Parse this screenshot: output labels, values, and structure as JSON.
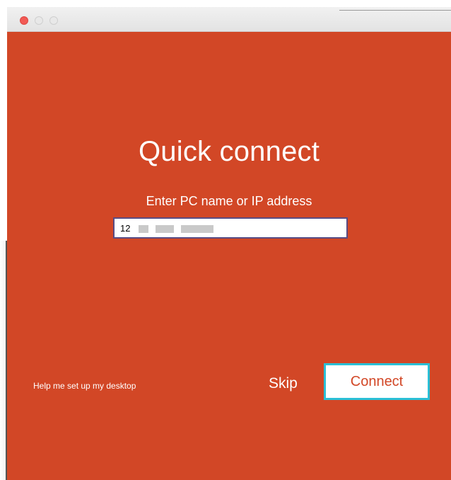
{
  "window": {
    "title": "",
    "accent_color": "#d24726"
  },
  "titlebar": {
    "close_icon": "close-icon",
    "minimize_icon": "minimize-icon",
    "maximize_icon": "maximize-icon"
  },
  "main": {
    "heading": "Quick connect",
    "prompt": "Enter PC name or IP address",
    "pc_input_value": "12"
  },
  "footer": {
    "help_link": "Help me set up my desktop",
    "skip_label": "Skip",
    "connect_label": "Connect",
    "connect_focus_color": "#2bbfd6"
  }
}
